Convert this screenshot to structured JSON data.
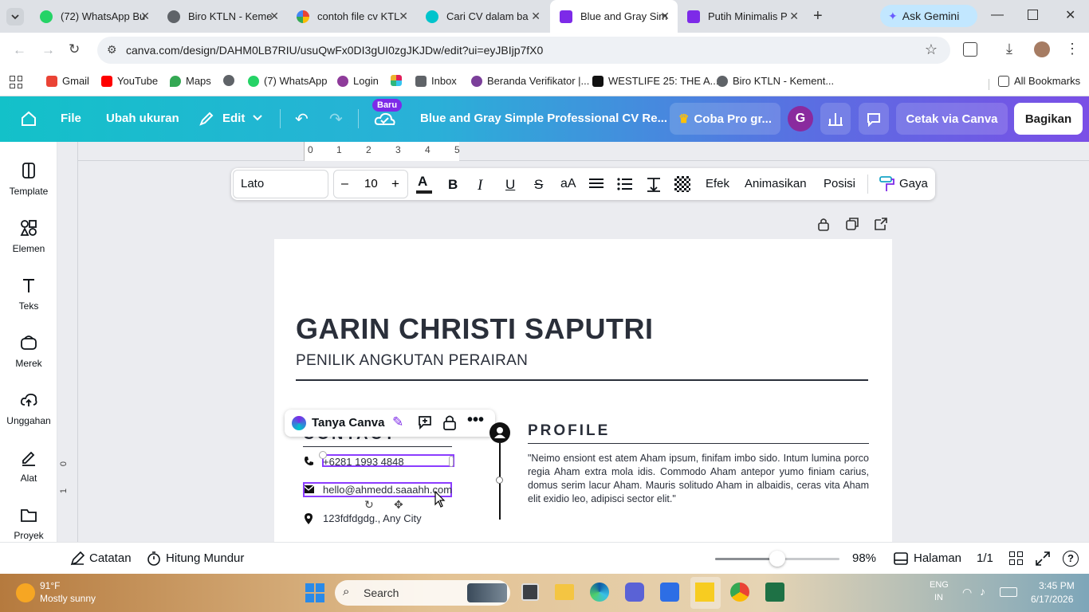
{
  "browser": {
    "tabs": [
      {
        "title": "(72) WhatsApp Bu",
        "badge": "72",
        "color": "#25d366"
      },
      {
        "title": "Biro KTLN - Keme",
        "color": "#5f6368"
      },
      {
        "title": "contoh file cv KTL",
        "color": "#4285f4"
      },
      {
        "title": "Cari CV dalam ba",
        "color": "#00c4cc"
      },
      {
        "title": "Blue and Gray Sim",
        "color": "#7d2ae8"
      },
      {
        "title": "Putih Minimalis P",
        "color": "#7d2ae8"
      }
    ],
    "ask_gemini": "Ask Gemini",
    "url": "canva.com/design/DAHM0LB7RIU/usuQwFx0DI3gUI0zgJKJDw/edit?ui=eyJBIjp7fX0",
    "bookmarks": [
      "Gmail",
      "YouTube",
      "Maps",
      "(7) WhatsApp",
      "Login",
      "Inbox",
      "Beranda Verifikator |...",
      "WESTLIFE 25: THE A...",
      "Biro KTLN - Kement..."
    ],
    "all_bookmarks": "All Bookmarks"
  },
  "canva": {
    "header": {
      "file": "File",
      "resize": "Ubah ukuran",
      "edit": "Edit",
      "new_badge": "Baru",
      "doc_title": "Blue and Gray Simple Professional CV Re...",
      "try_pro": "Coba Pro gr...",
      "avatar": "G",
      "print": "Cetak via Canva",
      "share": "Bagikan"
    },
    "rail": [
      "Template",
      "Elemen",
      "Teks",
      "Merek",
      "Unggahan",
      "Alat",
      "Proyek"
    ],
    "ruler_top": [
      "0",
      "1",
      "2",
      "3",
      "4",
      "5"
    ],
    "ruler_left": [
      "0",
      "1"
    ],
    "text_toolbar": {
      "font": "Lato",
      "minus": "–",
      "size": "10",
      "plus": "+",
      "bold": "B",
      "italic": "I",
      "underline": "U",
      "strike": "S",
      "case": "aA",
      "effects": "Efek",
      "animate": "Animasikan",
      "position": "Posisi",
      "style": "Gaya"
    },
    "cv": {
      "name": "GARIN CHRISTI SAPUTRI",
      "role": "PENILIK ANGKUTAN PERAIRAN",
      "contact_heading": "CONTACT",
      "phone": "+6281 1993 4848",
      "email": "hello@ahmedd.saaahh.com",
      "address": "123fdfdgdg., Any City",
      "profile_heading": "PROFILE",
      "profile_text": "\"Neimo ensiont est atem Aham ipsum, finifam imbo sido. Intum lumina porco regia Aham extra mola idis. Commodo Aham antepor yumo finiam carius, domus serim lacur Aham. Mauris solitudo Aham in albaidis, ceras vita Aham elit exidio leo, adipisci sector elit.\""
    },
    "floating": {
      "ask_canva": "Tanya Canva"
    },
    "bottom": {
      "notes": "Catatan",
      "timer": "Hitung Mundur",
      "zoom": "98%",
      "zoom_fraction": 0.5,
      "pages": "Halaman",
      "page_count": "1/1"
    }
  },
  "taskbar": {
    "weather_temp": "91°F",
    "weather_desc": "Mostly sunny",
    "search": "Search",
    "lang1": "ENG",
    "lang2": "IN",
    "time": "3:45 PM",
    "date": "6/17/2026"
  }
}
